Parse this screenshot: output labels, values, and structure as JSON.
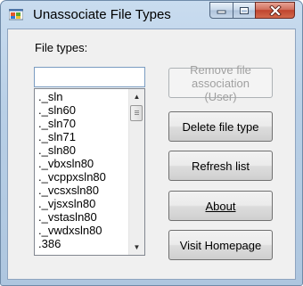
{
  "window": {
    "title": "Unassociate File Types",
    "app_icon": "windows-app-icon",
    "controls": {
      "minimize_icon": "minimize-icon",
      "maximize_icon": "maximize-icon",
      "close_icon": "close-icon"
    }
  },
  "form": {
    "file_types_label": "File types:",
    "search_value": "",
    "file_types": [
      "._sln",
      "._sln60",
      "._sln70",
      "._sln71",
      "._sln80",
      "._vbxsln80",
      "._vcppxsln80",
      "._vcsxsln80",
      "._vjsxsln80",
      "._vstasln80",
      "._vwdxsln80",
      ".386"
    ]
  },
  "buttons": {
    "remove_association": {
      "label": "Remove file association (User)",
      "enabled": false
    },
    "delete_file_type": "Delete file type",
    "refresh_list": "Refresh list",
    "about": "About",
    "visit_homepage": "Visit Homepage"
  },
  "colors": {
    "frame": "#b8cfe6",
    "close_button": "#c0452f",
    "client_background": "#f0f0f0",
    "disabled_text": "#a0a0a0"
  }
}
